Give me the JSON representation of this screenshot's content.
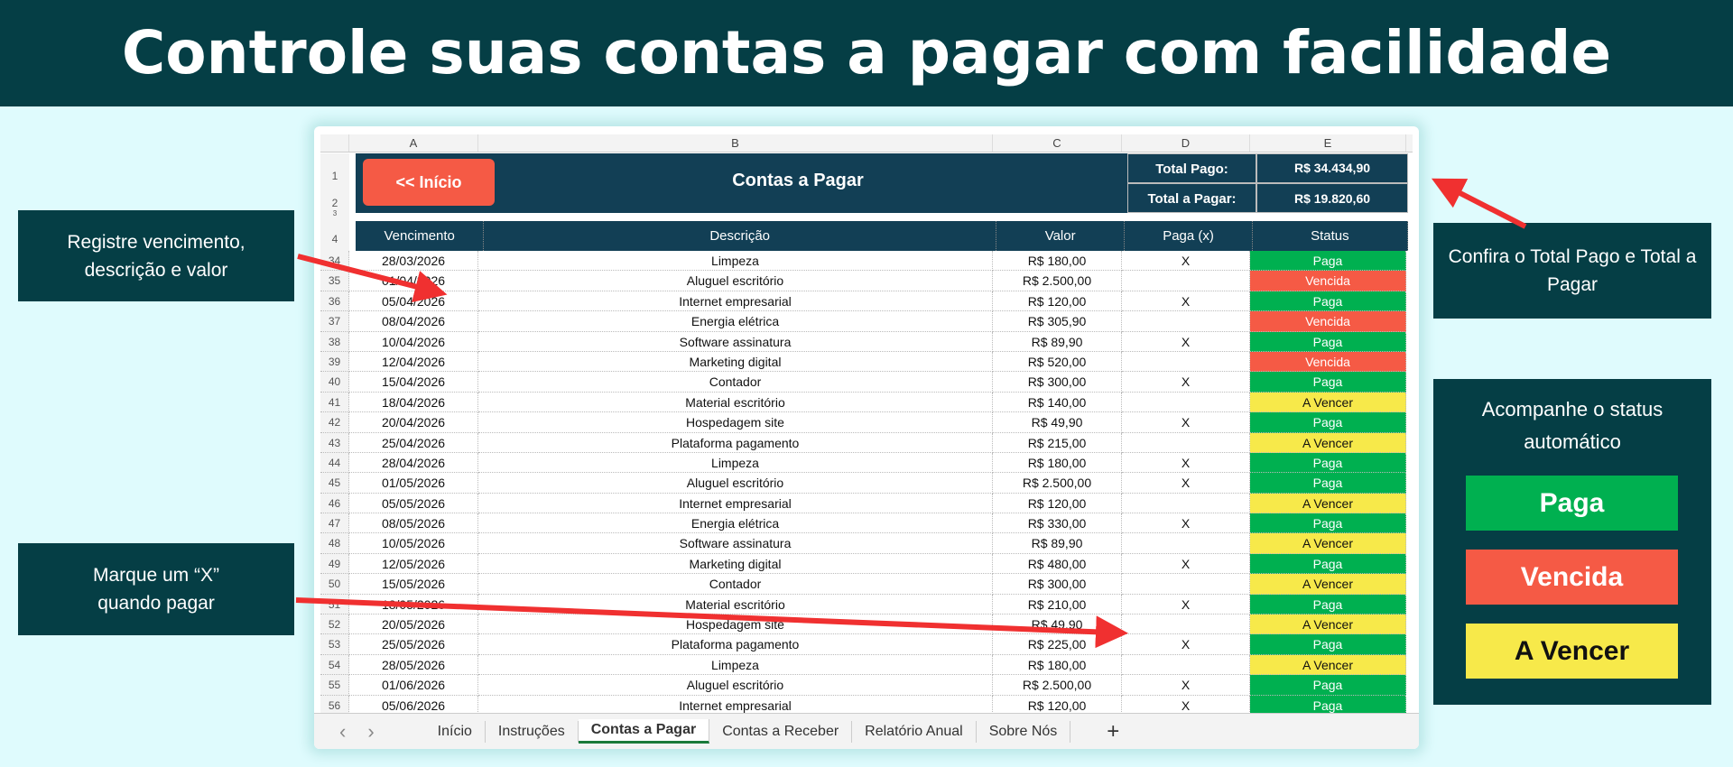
{
  "banner": {
    "title": "Controle suas contas a pagar com facilidade"
  },
  "sheet": {
    "columns": [
      "A",
      "B",
      "C",
      "D",
      "E"
    ],
    "row_numbers_top": [
      "1",
      "2",
      "3",
      "4"
    ],
    "start_button": "<< Início",
    "title": "Contas a Pagar",
    "total_pago_label": "Total Pago:",
    "total_pago_value": "R$ 34.434,90",
    "total_pagar_label": "Total a Pagar:",
    "total_pagar_value": "R$ 19.820,60",
    "headers": [
      "Vencimento",
      "Descrição",
      "Valor",
      "Paga (x)",
      "Status"
    ],
    "rows": [
      [
        "34",
        "28/03/2026",
        "Limpeza",
        "R$ 180,00",
        "X",
        "Paga"
      ],
      [
        "35",
        "01/04/2026",
        "Aluguel escritório",
        "R$ 2.500,00",
        "",
        "Vencida"
      ],
      [
        "36",
        "05/04/2026",
        "Internet empresarial",
        "R$ 120,00",
        "X",
        "Paga"
      ],
      [
        "37",
        "08/04/2026",
        "Energia elétrica",
        "R$ 305,90",
        "",
        "Vencida"
      ],
      [
        "38",
        "10/04/2026",
        "Software assinatura",
        "R$ 89,90",
        "X",
        "Paga"
      ],
      [
        "39",
        "12/04/2026",
        "Marketing digital",
        "R$ 520,00",
        "",
        "Vencida"
      ],
      [
        "40",
        "15/04/2026",
        "Contador",
        "R$ 300,00",
        "X",
        "Paga"
      ],
      [
        "41",
        "18/04/2026",
        "Material escritório",
        "R$ 140,00",
        "",
        "A Vencer"
      ],
      [
        "42",
        "20/04/2026",
        "Hospedagem site",
        "R$ 49,90",
        "X",
        "Paga"
      ],
      [
        "43",
        "25/04/2026",
        "Plataforma pagamento",
        "R$ 215,00",
        "",
        "A Vencer"
      ],
      [
        "44",
        "28/04/2026",
        "Limpeza",
        "R$ 180,00",
        "X",
        "Paga"
      ],
      [
        "45",
        "01/05/2026",
        "Aluguel escritório",
        "R$ 2.500,00",
        "X",
        "Paga"
      ],
      [
        "46",
        "05/05/2026",
        "Internet empresarial",
        "R$ 120,00",
        "",
        "A Vencer"
      ],
      [
        "47",
        "08/05/2026",
        "Energia elétrica",
        "R$ 330,00",
        "X",
        "Paga"
      ],
      [
        "48",
        "10/05/2026",
        "Software assinatura",
        "R$ 89,90",
        "",
        "A Vencer"
      ],
      [
        "49",
        "12/05/2026",
        "Marketing digital",
        "R$ 480,00",
        "X",
        "Paga"
      ],
      [
        "50",
        "15/05/2026",
        "Contador",
        "R$ 300,00",
        "",
        "A Vencer"
      ],
      [
        "51",
        "18/05/2026",
        "Material escritório",
        "R$ 210,00",
        "X",
        "Paga"
      ],
      [
        "52",
        "20/05/2026",
        "Hospedagem site",
        "R$ 49,90",
        "",
        "A Vencer"
      ],
      [
        "53",
        "25/05/2026",
        "Plataforma pagamento",
        "R$ 225,00",
        "X",
        "Paga"
      ],
      [
        "54",
        "28/05/2026",
        "Limpeza",
        "R$ 180,00",
        "",
        "A Vencer"
      ],
      [
        "55",
        "01/06/2026",
        "Aluguel escritório",
        "R$ 2.500,00",
        "X",
        "Paga"
      ],
      [
        "56",
        "05/06/2026",
        "Internet empresarial",
        "R$ 120,00",
        "X",
        "Paga"
      ]
    ],
    "tabs": [
      "Início",
      "Instruções",
      "Contas a Pagar",
      "Contas a Receber",
      "Relatório Anual",
      "Sobre Nós"
    ],
    "active_tab": "Contas a Pagar",
    "nav_prev": "‹",
    "nav_next": "›",
    "add_tab": "+"
  },
  "callouts": {
    "register": "Registre vencimento, descrição e valor",
    "mark": "Marque um “X” quando pagar",
    "totals": "Confira o Total Pago e Total a Pagar",
    "status": "Acompanhe o status automático"
  },
  "legend": {
    "paga": "Paga",
    "vencida": "Vencida",
    "a_vencer": "A Vencer"
  },
  "colors": {
    "banner": "#053e45",
    "paga": "#00b050",
    "vencida": "#f55a45",
    "a_vencer": "#f7e94a",
    "header": "#123f55",
    "arrow": "#f03030"
  }
}
